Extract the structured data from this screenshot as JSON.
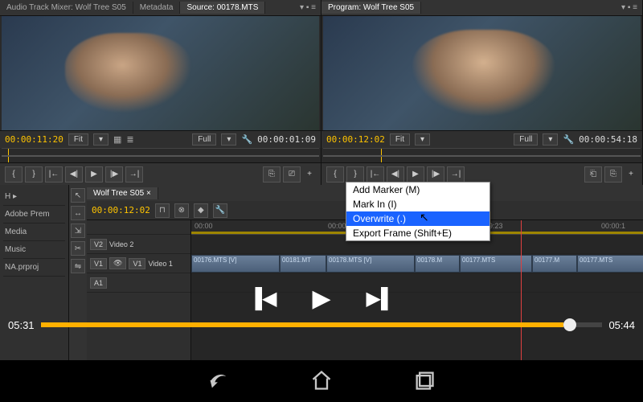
{
  "source": {
    "tabs": {
      "mixer": "Audio Track Mixer: Wolf Tree S05",
      "metadata": "Metadata",
      "source": "Source: 00178.MTS"
    },
    "in_tc": "00:00:11:20",
    "fit": "Fit",
    "full": "Full",
    "out_tc": "00:00:01:09"
  },
  "program": {
    "tab": "Program: Wolf Tree S05",
    "in_tc": "00:00:12:02",
    "fit": "Fit",
    "full": "Full",
    "out_tc": "00:00:54:18"
  },
  "project": {
    "items": [
      "Adobe Prem",
      "Media",
      "Music",
      "NA.prproj"
    ],
    "expand": "H ▸"
  },
  "sequence": {
    "tab": "Wolf Tree S05",
    "tc": "00:00:12:02",
    "ruler": [
      "00:00",
      "00:00:04:23",
      "00:00:09:23",
      "00:00:1"
    ],
    "v2": "V2",
    "v2_name": "Video 2",
    "v1": "V1",
    "v1_name": "Video 1",
    "a1": "A1",
    "clips": [
      "00176.MTS [V]",
      "00181.MT",
      "00178.MTS [V]",
      "00178.M",
      "00177.MTS",
      "00177.M",
      "00177.MTS"
    ]
  },
  "context_menu": {
    "items": [
      "Add Marker (M)",
      "Mark In (I)",
      "Overwrite (.)",
      "Export Frame (Shift+E)"
    ]
  },
  "overlay": {
    "current": "05:31",
    "total": "05:44"
  },
  "transport_icons": {
    "mark_in": "{",
    "mark_out": "}",
    "goto_in": "|←",
    "step_back": "◀|",
    "play": "▶",
    "step_fwd": "|▶",
    "goto_out": "→|",
    "insert": "⎘",
    "overwrite": "⎚"
  }
}
